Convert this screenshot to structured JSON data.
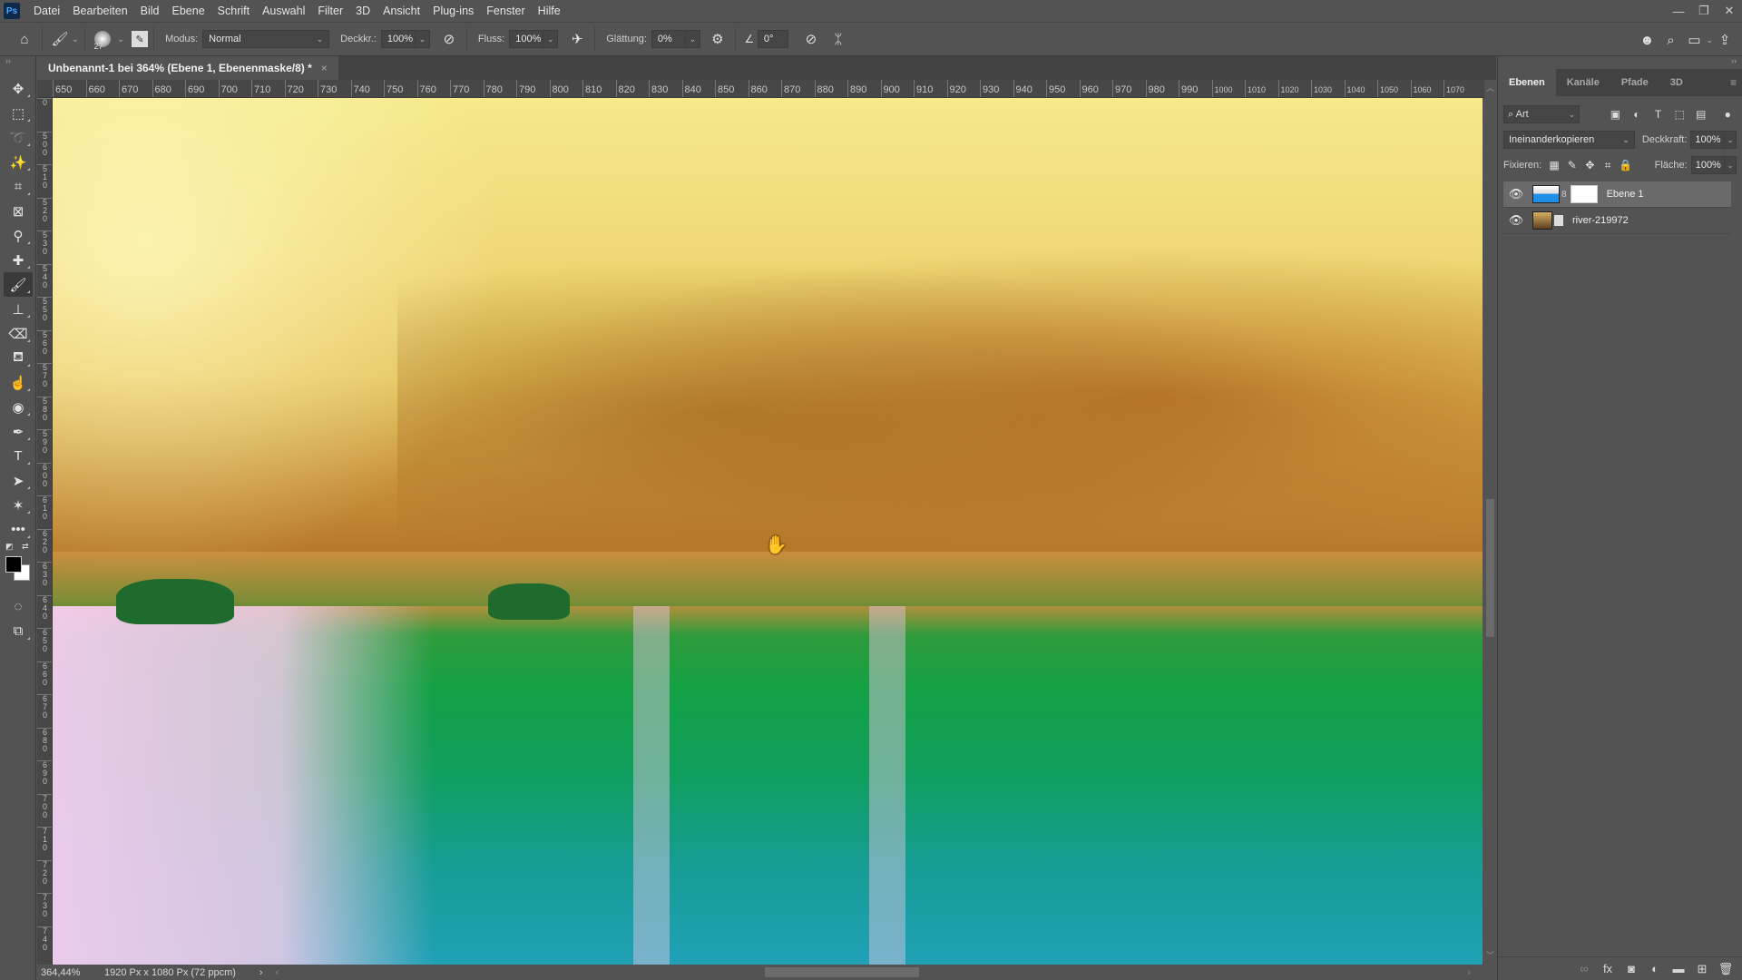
{
  "app": {
    "logo": "Ps"
  },
  "menu": [
    "Datei",
    "Bearbeiten",
    "Bild",
    "Ebene",
    "Schrift",
    "Auswahl",
    "Filter",
    "3D",
    "Ansicht",
    "Plug-ins",
    "Fenster",
    "Hilfe"
  ],
  "window_controls": {
    "minimize": "—",
    "restore": "❐",
    "close": "✕"
  },
  "options": {
    "brush_size": "27",
    "mode_label": "Modus:",
    "mode_value": "Normal",
    "opacity_label": "Deckkr.:",
    "opacity_value": "100%",
    "flow_label": "Fluss:",
    "flow_value": "100%",
    "smoothing_label": "Glättung:",
    "smoothing_value": "0%",
    "angle_value": "0°"
  },
  "document": {
    "tab_title": "Unbenannt-1 bei 364% (Ebene 1, Ebenenmaske/8) *",
    "close": "×"
  },
  "ruler_top": [
    "650",
    "660",
    "670",
    "680",
    "690",
    "700",
    "710",
    "720",
    "730",
    "740",
    "750",
    "760",
    "770",
    "780",
    "790",
    "800",
    "810",
    "820",
    "830",
    "840",
    "850",
    "860",
    "870",
    "880",
    "890",
    "900",
    "910",
    "920",
    "930",
    "940",
    "950",
    "960",
    "970",
    "980",
    "990",
    "1000",
    "1010",
    "1020",
    "1030",
    "1040",
    "1050",
    "1060",
    "1070"
  ],
  "ruler_left": [
    "0",
    "500",
    "510",
    "520",
    "530",
    "540",
    "550",
    "560",
    "570",
    "580",
    "590",
    "600",
    "610",
    "620",
    "630",
    "640",
    "650",
    "660",
    "670",
    "680",
    "690",
    "700",
    "710",
    "720",
    "730",
    "740"
  ],
  "status": {
    "zoom": "364,44%",
    "doc_info": "1920 Px x 1080 Px (72 ppcm)",
    "arrow": "›"
  },
  "layers_panel": {
    "tabs": [
      "Ebenen",
      "Kanäle",
      "Pfade",
      "3D"
    ],
    "active_tab": 0,
    "filter_value": "Art",
    "blend_mode": "Ineinanderkopieren",
    "opacity_label": "Deckkraft:",
    "opacity_value": "100%",
    "lock_label": "Fixieren:",
    "fill_label": "Fläche:",
    "fill_value": "100%",
    "layers": [
      {
        "name": "Ebene 1",
        "visible": true,
        "selected": true,
        "has_mask": true
      },
      {
        "name": "river-219972",
        "visible": true,
        "selected": false,
        "smart_object": true
      }
    ]
  }
}
